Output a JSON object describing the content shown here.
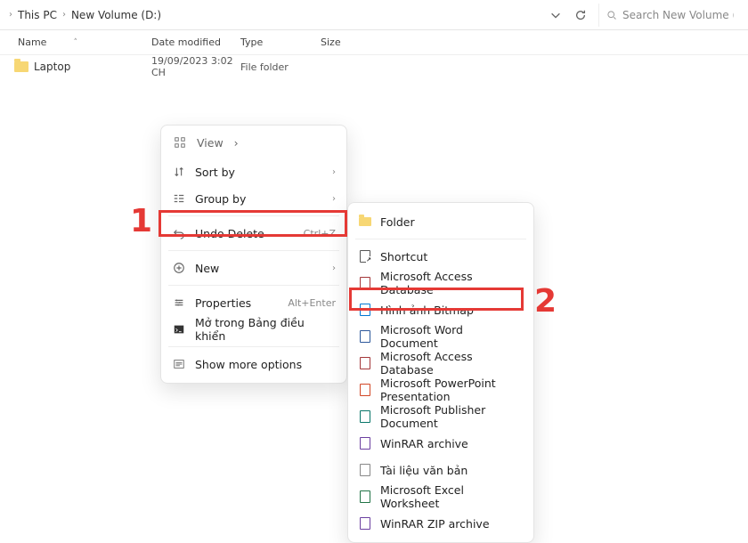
{
  "breadcrumb": {
    "p1": "This PC",
    "p2": "New Volume (D:)"
  },
  "search": {
    "placeholder": "Search New Volume (D:)"
  },
  "columns": {
    "name": "Name",
    "date": "Date modified",
    "type": "Type",
    "size": "Size"
  },
  "files": [
    {
      "name": "Laptop",
      "date": "19/09/2023 3:02 CH",
      "type": "File folder"
    }
  ],
  "menu1": {
    "view": "View",
    "sort": "Sort by",
    "group": "Group by",
    "undo": "Undo Delete",
    "undo_sc": "Ctrl+Z",
    "new": "New",
    "props": "Properties",
    "props_sc": "Alt+Enter",
    "open_cp": "Mở trong Bảng điều khiển",
    "more": "Show more options"
  },
  "menu2": {
    "items": [
      {
        "label": "Folder",
        "cls": "fi-folder"
      },
      {
        "label": "Shortcut",
        "cls": "fi-link"
      },
      {
        "label": "Microsoft Access Database",
        "cls": "fi-access"
      },
      {
        "label": "Hình ảnh Bitmap",
        "cls": "fi-bmp"
      },
      {
        "label": "Microsoft Word Document",
        "cls": "fi-word"
      },
      {
        "label": "Microsoft Access Database",
        "cls": "fi-access"
      },
      {
        "label": "Microsoft PowerPoint Presentation",
        "cls": "fi-ppt"
      },
      {
        "label": "Microsoft Publisher Document",
        "cls": "fi-pub"
      },
      {
        "label": "WinRAR archive",
        "cls": "fi-rar"
      },
      {
        "label": "Tài liệu văn bản",
        "cls": "fi-txt"
      },
      {
        "label": "Microsoft Excel Worksheet",
        "cls": "fi-xls"
      },
      {
        "label": "WinRAR ZIP archive",
        "cls": "fi-rar"
      }
    ]
  },
  "annot": {
    "n1": "1",
    "n2": "2"
  }
}
